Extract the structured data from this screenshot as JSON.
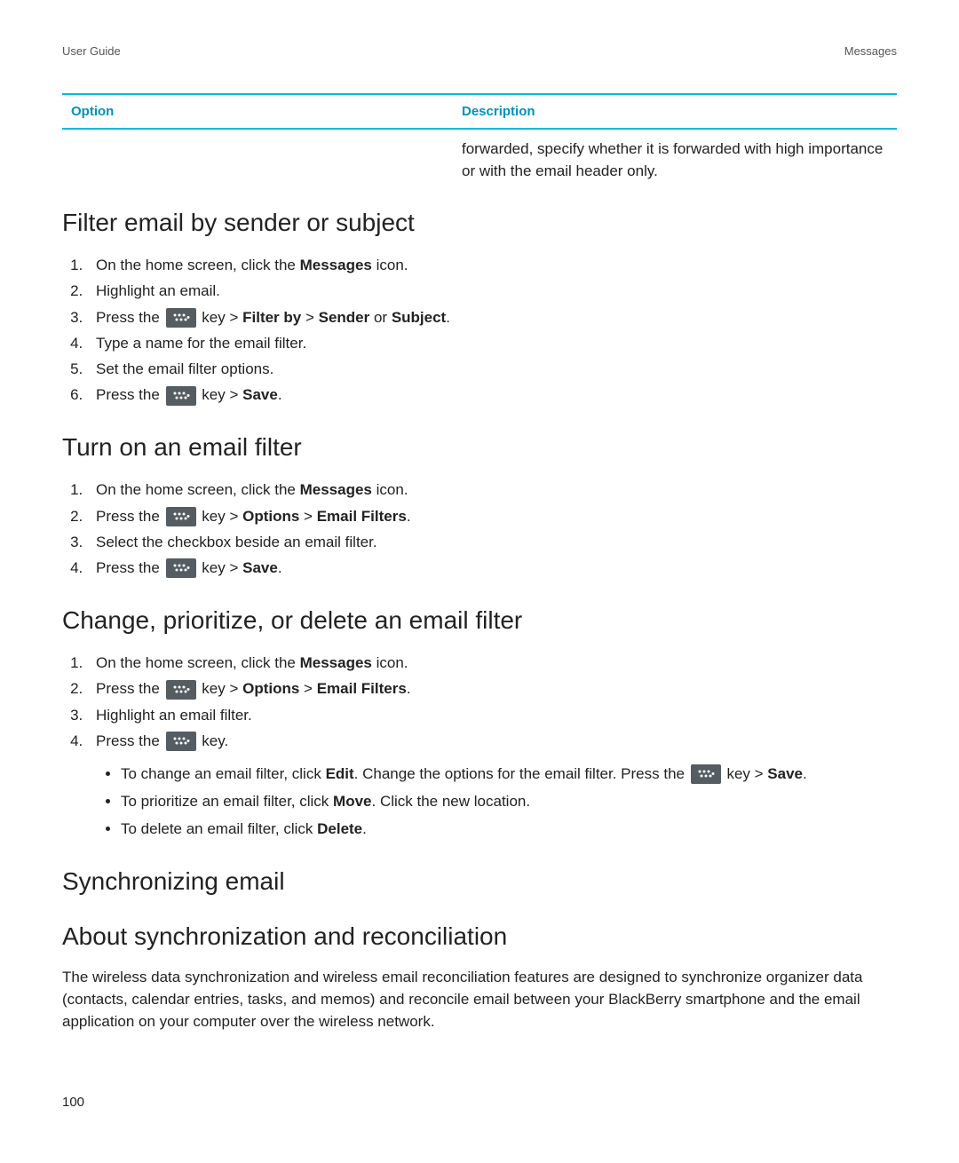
{
  "header": {
    "left": "User Guide",
    "right": "Messages"
  },
  "table": {
    "head_option": "Option",
    "head_description": "Description",
    "desc_text": "forwarded, specify whether it is forwarded with high importance or with the email header only."
  },
  "sec1": {
    "title": "Filter email by sender or subject",
    "s1a": "On the home screen, click the ",
    "s1b": "Messages",
    "s1c": " icon.",
    "s2": "Highlight an email.",
    "s3a": "Press the ",
    "s3b": " key > ",
    "s3c": "Filter by",
    "s3d": " > ",
    "s3e": "Sender",
    "s3f": " or ",
    "s3g": "Subject",
    "s3h": ".",
    "s4": "Type a name for the email filter.",
    "s5": "Set the email filter options.",
    "s6a": "Press the ",
    "s6b": " key > ",
    "s6c": "Save",
    "s6d": "."
  },
  "sec2": {
    "title": "Turn on an email filter",
    "s1a": "On the home screen, click the ",
    "s1b": "Messages",
    "s1c": " icon.",
    "s2a": "Press the ",
    "s2b": " key > ",
    "s2c": "Options",
    "s2d": " > ",
    "s2e": "Email Filters",
    "s2f": ".",
    "s3": "Select the checkbox beside an email filter.",
    "s4a": "Press the ",
    "s4b": " key > ",
    "s4c": "Save",
    "s4d": "."
  },
  "sec3": {
    "title": "Change, prioritize, or delete an email filter",
    "s1a": "On the home screen, click the ",
    "s1b": "Messages",
    "s1c": " icon.",
    "s2a": "Press the ",
    "s2b": " key > ",
    "s2c": "Options",
    "s2d": " > ",
    "s2e": "Email Filters",
    "s2f": ".",
    "s3": "Highlight an email filter.",
    "s4a": "Press the ",
    "s4b": " key.",
    "b1a": "To change an email filter, click ",
    "b1b": "Edit",
    "b1c": ". Change the options for the email filter. Press the ",
    "b1d": " key > ",
    "b1e": "Save",
    "b1f": ".",
    "b2a": "To prioritize an email filter, click ",
    "b2b": "Move",
    "b2c": ". Click the new location.",
    "b3a": "To delete an email filter, click ",
    "b3b": "Delete",
    "b3c": "."
  },
  "sec4": {
    "title": "Synchronizing email"
  },
  "sec5": {
    "title": "About synchronization and reconciliation",
    "body": "The wireless data synchronization and wireless email reconciliation features are designed to synchronize organizer data (contacts, calendar entries, tasks, and memos) and reconcile email between your BlackBerry smartphone and the email application on your computer over the wireless network."
  },
  "page_number": "100"
}
